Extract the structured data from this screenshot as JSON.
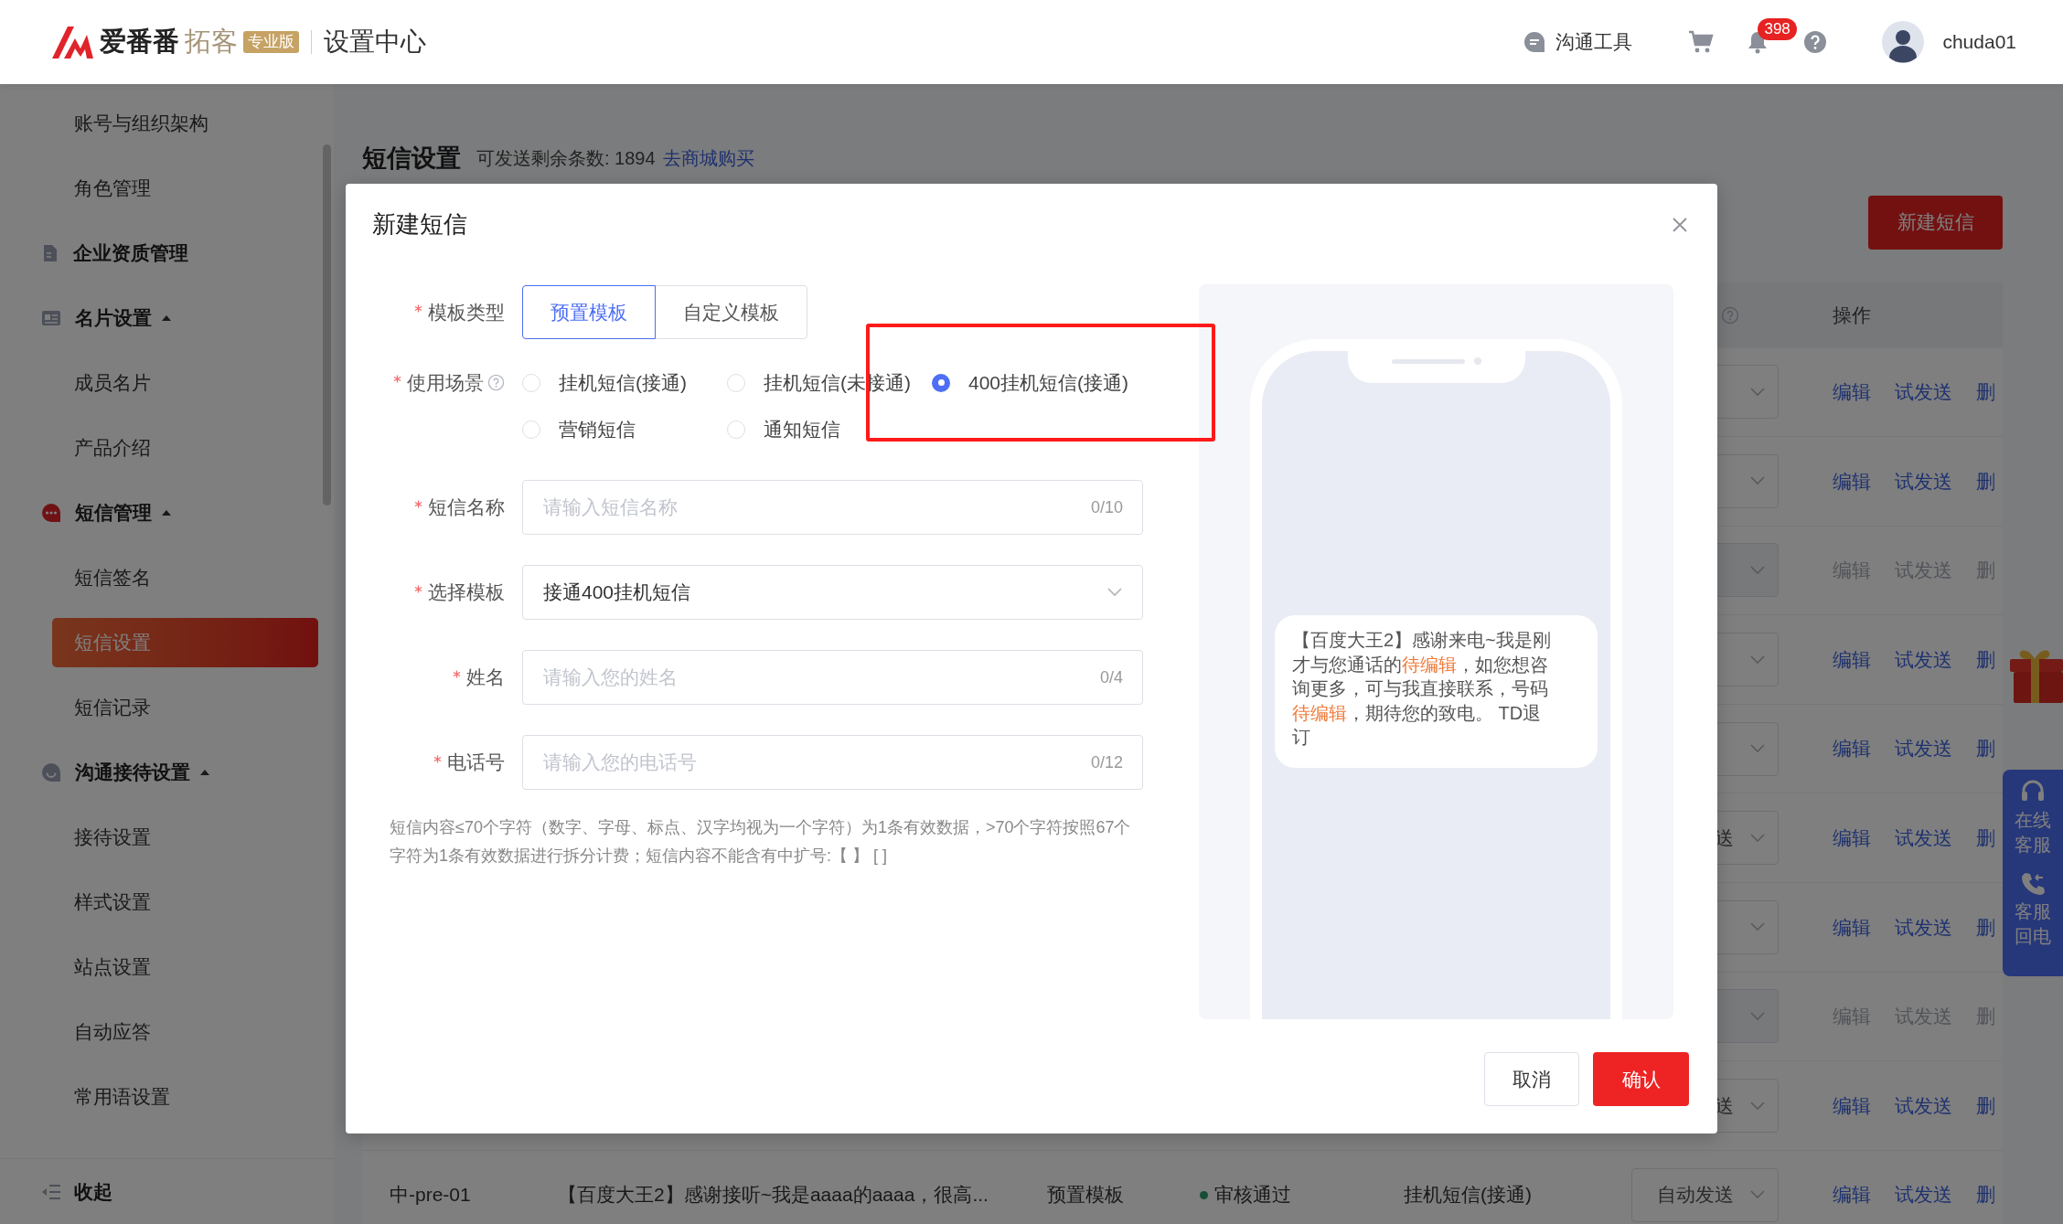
{
  "header": {
    "logo_name": "爱番番",
    "logo_product": "拓客",
    "edition_badge": "专业版",
    "section_title": "设置中心",
    "tool_label": "沟通工具",
    "notification_count": "398",
    "username": "chuda01"
  },
  "sidebar": {
    "items": [
      {
        "kind": "item",
        "label": "账号与组织架构",
        "selected": false
      },
      {
        "kind": "item",
        "label": "角色管理",
        "selected": false
      },
      {
        "kind": "group",
        "label": "企业资质管理"
      },
      {
        "kind": "group",
        "label": "名片设置",
        "expanded": true,
        "children": [
          {
            "kind": "item",
            "label": "成员名片",
            "selected": false
          },
          {
            "kind": "item",
            "label": "产品介绍",
            "selected": false
          }
        ]
      },
      {
        "kind": "group",
        "label": "短信管理",
        "expanded": true,
        "children": [
          {
            "kind": "item",
            "label": "短信签名",
            "selected": false
          },
          {
            "kind": "item",
            "label": "短信设置",
            "selected": true
          },
          {
            "kind": "item",
            "label": "短信记录",
            "selected": false
          }
        ]
      },
      {
        "kind": "group",
        "label": "沟通接待设置",
        "expanded": true,
        "children": [
          {
            "kind": "item",
            "label": "接待设置",
            "selected": false
          },
          {
            "kind": "item",
            "label": "样式设置",
            "selected": false
          },
          {
            "kind": "item",
            "label": "站点设置",
            "selected": false
          },
          {
            "kind": "item",
            "label": "自动应答",
            "selected": false
          },
          {
            "kind": "item",
            "label": "常用语设置",
            "selected": false
          }
        ]
      }
    ],
    "collapse_label": "收起"
  },
  "page": {
    "title": "短信设置",
    "remaining_label": "可发送剩余条数: 1894",
    "store_link": "去商城购买",
    "new_button": "新建短信"
  },
  "table": {
    "columns": [
      {
        "label": "操作"
      }
    ],
    "rows": [
      {
        "disabled": false,
        "actions": [
          "编辑",
          "试发送",
          "删"
        ]
      },
      {
        "disabled": false,
        "actions": [
          "编辑",
          "试发送",
          "删"
        ]
      },
      {
        "disabled": true,
        "actions": [
          "编辑",
          "试发送",
          "删"
        ]
      },
      {
        "disabled": false,
        "actions": [
          "编辑",
          "试发送",
          "删"
        ]
      },
      {
        "disabled": false,
        "actions": [
          "编辑",
          "试发送",
          "删"
        ]
      },
      {
        "disabled": false,
        "send_mode": "送",
        "actions": [
          "编辑",
          "试发送",
          "删"
        ]
      },
      {
        "disabled": false,
        "actions": [
          "编辑",
          "试发送",
          "删"
        ]
      },
      {
        "disabled": true,
        "actions": [
          "编辑",
          "试发送",
          "删"
        ]
      },
      {
        "disabled": false,
        "send_mode": "送",
        "actions": [
          "编辑",
          "试发送",
          "删"
        ]
      },
      {
        "disabled": false,
        "cells": [
          {
            "text": "中-pre-01"
          },
          {
            "text": "【百度大王2】感谢接听~我是aaaa的aaaa，很高..."
          },
          {
            "text": "预置模板"
          },
          {
            "text": "审核通过",
            "kind": "status"
          },
          {
            "text": "挂机短信(接通)"
          }
        ],
        "send_mode": "自动发送",
        "actions": [
          "编辑",
          "试发送",
          "删"
        ]
      }
    ]
  },
  "service_panel": {
    "items": [
      {
        "label": "在线客服"
      },
      {
        "label": "客服回电"
      }
    ]
  },
  "modal": {
    "title": "新建短信",
    "fields": [
      {
        "kind": "toggle",
        "label": "模板类型",
        "required": true,
        "options": [
          {
            "label": "预置模板",
            "selected": true
          },
          {
            "label": "自定义模板",
            "selected": false
          }
        ]
      },
      {
        "kind": "radio",
        "label": "使用场景",
        "required": true,
        "help": true,
        "options": [
          {
            "label": "挂机短信(接通)",
            "selected": false
          },
          {
            "label": "挂机短信(未接通)",
            "selected": false
          },
          {
            "label": "400挂机短信(接通)",
            "selected": true
          },
          {
            "label": "营销短信",
            "selected": false
          },
          {
            "label": "通知短信",
            "selected": false
          }
        ]
      },
      {
        "kind": "input",
        "label": "短信名称",
        "required": true,
        "placeholder": "请输入短信名称",
        "counter": "0/10"
      },
      {
        "kind": "select",
        "label": "选择模板",
        "required": true,
        "value": "接通400挂机短信"
      },
      {
        "kind": "input",
        "label": "姓名",
        "required": true,
        "placeholder": "请输入您的姓名",
        "counter": "0/4"
      },
      {
        "kind": "input",
        "label": "电话号",
        "required": true,
        "placeholder": "请输入您的电话号",
        "counter": "0/12"
      }
    ],
    "note": "短信内容≤70个字符（数字、字母、标点、汉字均视为一个字符）为1条有效数据，>70个字符按照67个字符为1条有效数据进行拆分计费；短信内容不能含有中扩号:【 】 [ ]",
    "preview": {
      "message": [
        {
          "kind": "plain",
          "text": "【百度大王2】感谢来电~我是刚才与您通话的"
        },
        {
          "kind": "variable",
          "text": "待编辑"
        },
        {
          "kind": "plain",
          "text": "，如您想咨询更多，可与我直接联系，号码"
        },
        {
          "kind": "variable",
          "text": "待编辑"
        },
        {
          "kind": "plain",
          "text": "，期待您的致电。 TD退订"
        }
      ]
    },
    "buttons": [
      {
        "kind": "secondary",
        "label": "取消"
      },
      {
        "kind": "primary",
        "label": "确认"
      }
    ]
  }
}
